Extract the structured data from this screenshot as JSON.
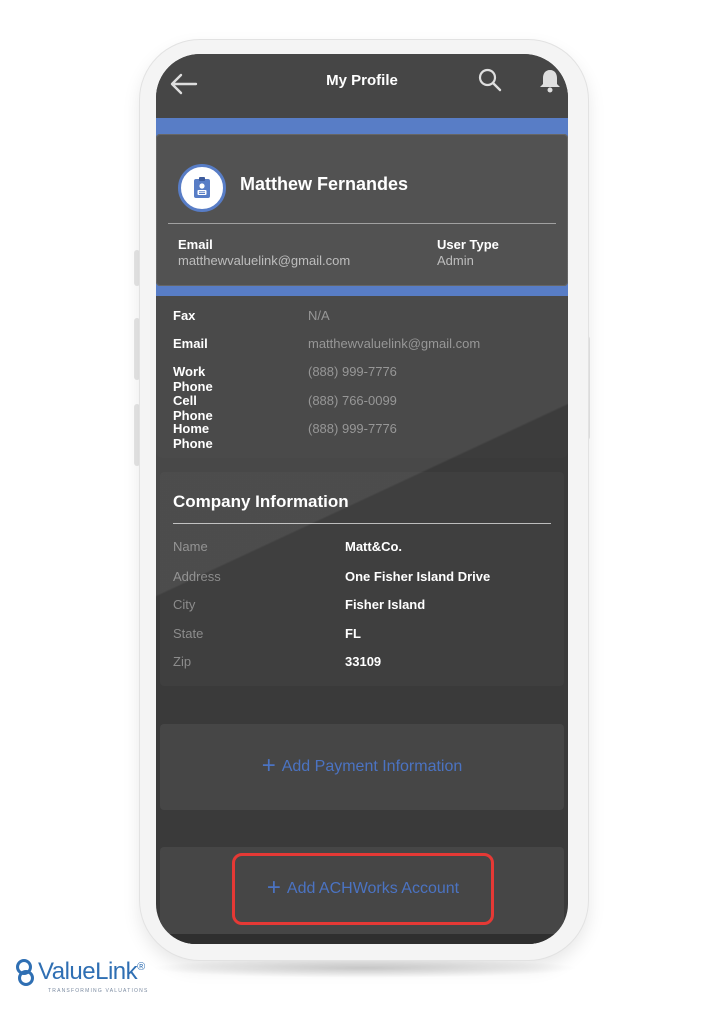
{
  "header": {
    "title": "My Profile"
  },
  "profile": {
    "name": "Matthew Fernandes",
    "email_label": "Email",
    "email_value": "matthewvaluelink@gmail.com",
    "user_type_label": "User Type",
    "user_type_value": "Admin"
  },
  "contact": [
    {
      "label": "Fax",
      "value": "N/A"
    },
    {
      "label": "Email",
      "value": "matthewvaluelink@gmail.com"
    },
    {
      "label": "Work Phone",
      "value": "(888) 999-7776"
    },
    {
      "label": "Cell Phone",
      "value": "(888) 766-0099"
    },
    {
      "label": "Home Phone",
      "value": "(888) 999-7776"
    }
  ],
  "company": {
    "title": "Company Information",
    "rows": [
      {
        "label": "Name",
        "value": "Matt&Co."
      },
      {
        "label": "Address",
        "value": "One Fisher Island Drive"
      },
      {
        "label": "City",
        "value": "Fisher Island"
      },
      {
        "label": "State",
        "value": "FL"
      },
      {
        "label": "Zip",
        "value": "33109"
      }
    ]
  },
  "actions": {
    "plus_symbol": "+",
    "add_payment_label": "Add Payment Information",
    "add_ach_label": "Add ACHWorks Account"
  },
  "branding": {
    "logo_text": "ValueLink",
    "logo_mark": "®",
    "tagline": "TRANSFORMING VALUATIONS"
  },
  "colors": {
    "accent_blue": "#4b73c2",
    "highlight_red": "#e53935",
    "screen_bg": "#3a3a3a"
  },
  "icons": [
    "back-arrow-icon",
    "search-icon",
    "bell-icon",
    "id-badge-icon",
    "plus-icon",
    "valuelink-logo-icon"
  ]
}
